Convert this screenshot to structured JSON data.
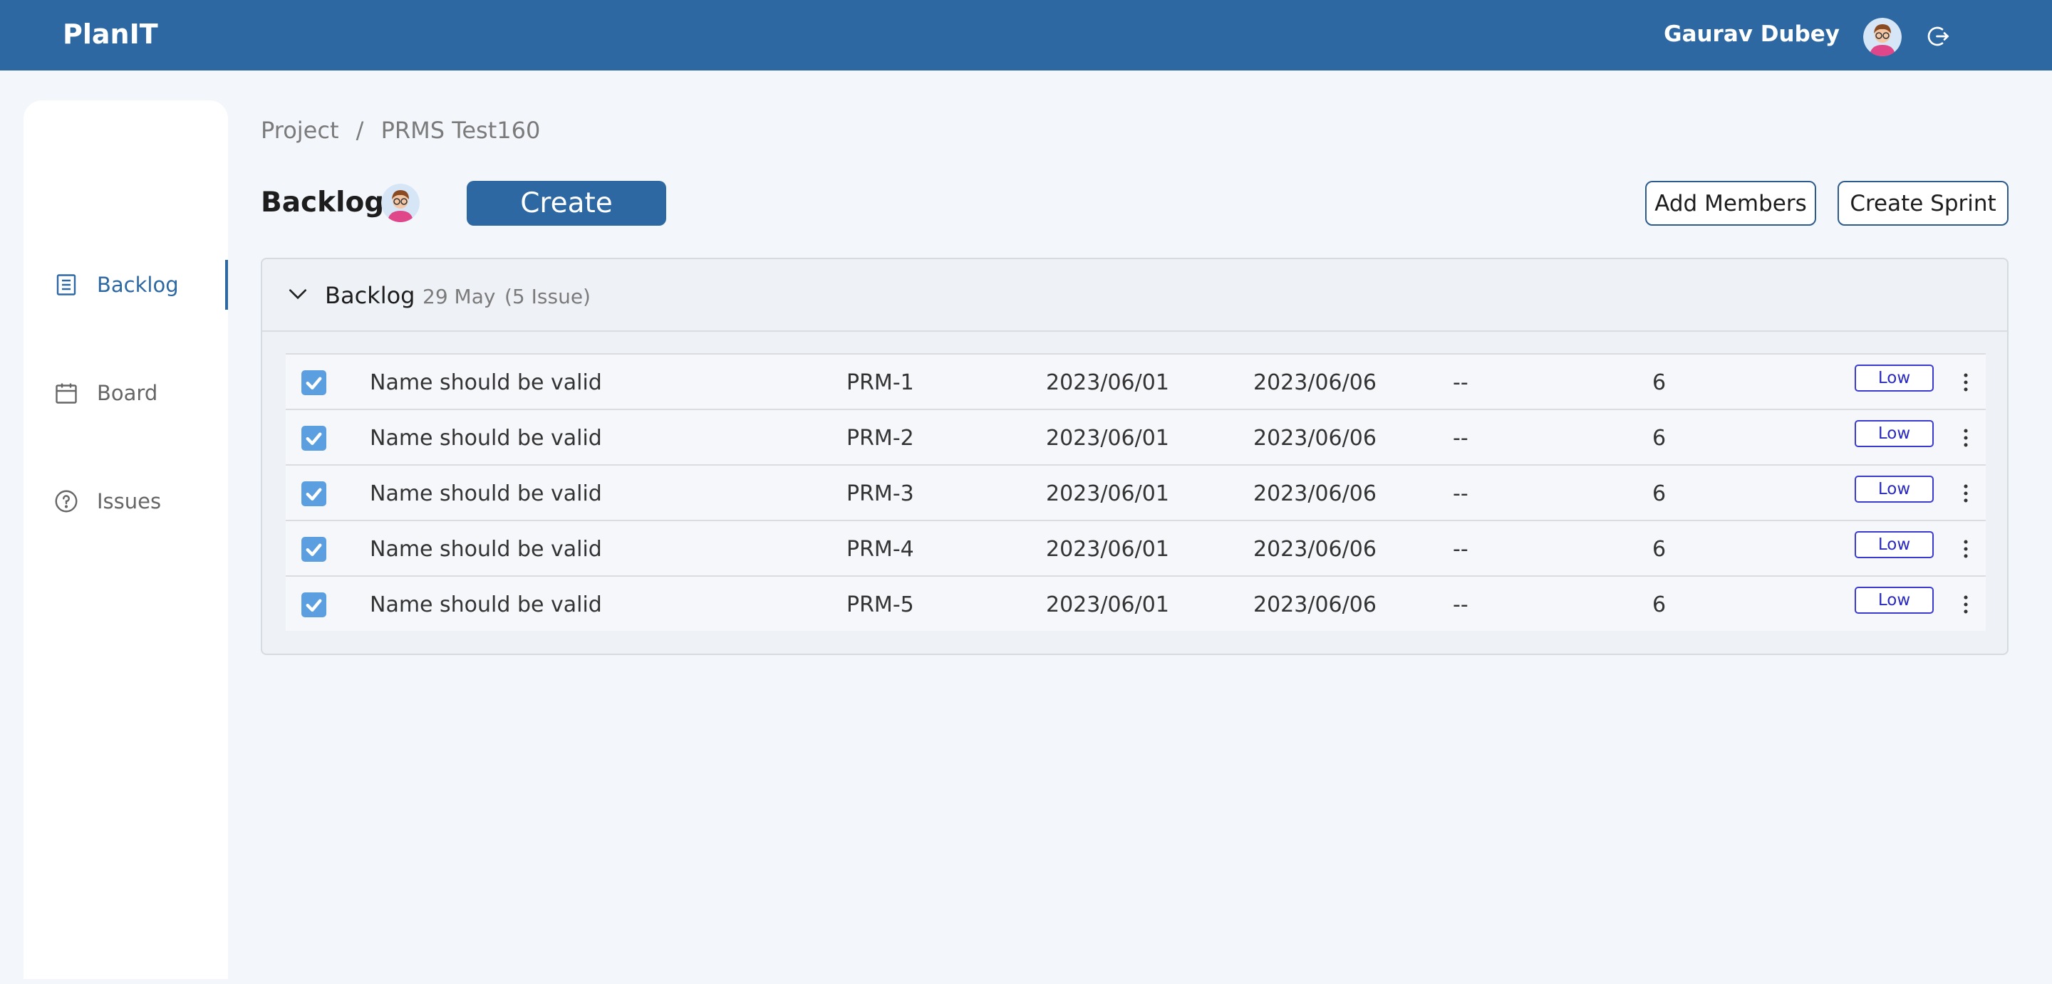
{
  "app": {
    "brand": "PlanIT"
  },
  "header": {
    "user_name": "Gaurav Dubey"
  },
  "sidebar": {
    "items": [
      {
        "label": "Backlog",
        "icon": "list-icon",
        "active": true
      },
      {
        "label": "Board",
        "icon": "calendar-icon",
        "active": false
      },
      {
        "label": "Issues",
        "icon": "help-circle-icon",
        "active": false
      }
    ]
  },
  "breadcrumb": {
    "root": "Project",
    "separator": "/",
    "current": "PRMS Test160"
  },
  "page": {
    "title": "Backlog",
    "create_label": "Create",
    "add_members_label": "Add Members",
    "create_sprint_label": "Create Sprint"
  },
  "backlog": {
    "title": "Backlog",
    "date": "29 May",
    "count": "(5 Issue)",
    "issues": [
      {
        "checked": true,
        "name": "Name should be valid",
        "key": "PRM-1",
        "start": "2023/06/01",
        "end": "2023/06/06",
        "assignee": "--",
        "points": "6",
        "priority": "Low"
      },
      {
        "checked": true,
        "name": "Name should be valid",
        "key": "PRM-2",
        "start": "2023/06/01",
        "end": "2023/06/06",
        "assignee": "--",
        "points": "6",
        "priority": "Low"
      },
      {
        "checked": true,
        "name": "Name should be valid",
        "key": "PRM-3",
        "start": "2023/06/01",
        "end": "2023/06/06",
        "assignee": "--",
        "points": "6",
        "priority": "Low"
      },
      {
        "checked": true,
        "name": "Name should be valid",
        "key": "PRM-4",
        "start": "2023/06/01",
        "end": "2023/06/06",
        "assignee": "--",
        "points": "6",
        "priority": "Low"
      },
      {
        "checked": true,
        "name": "Name should be valid",
        "key": "PRM-5",
        "start": "2023/06/01",
        "end": "2023/06/06",
        "assignee": "--",
        "points": "6",
        "priority": "Low"
      }
    ]
  },
  "colors": {
    "primary": "#2d68a3",
    "checkbox": "#5b9fe0",
    "priority_low": "#3a3ad0"
  }
}
